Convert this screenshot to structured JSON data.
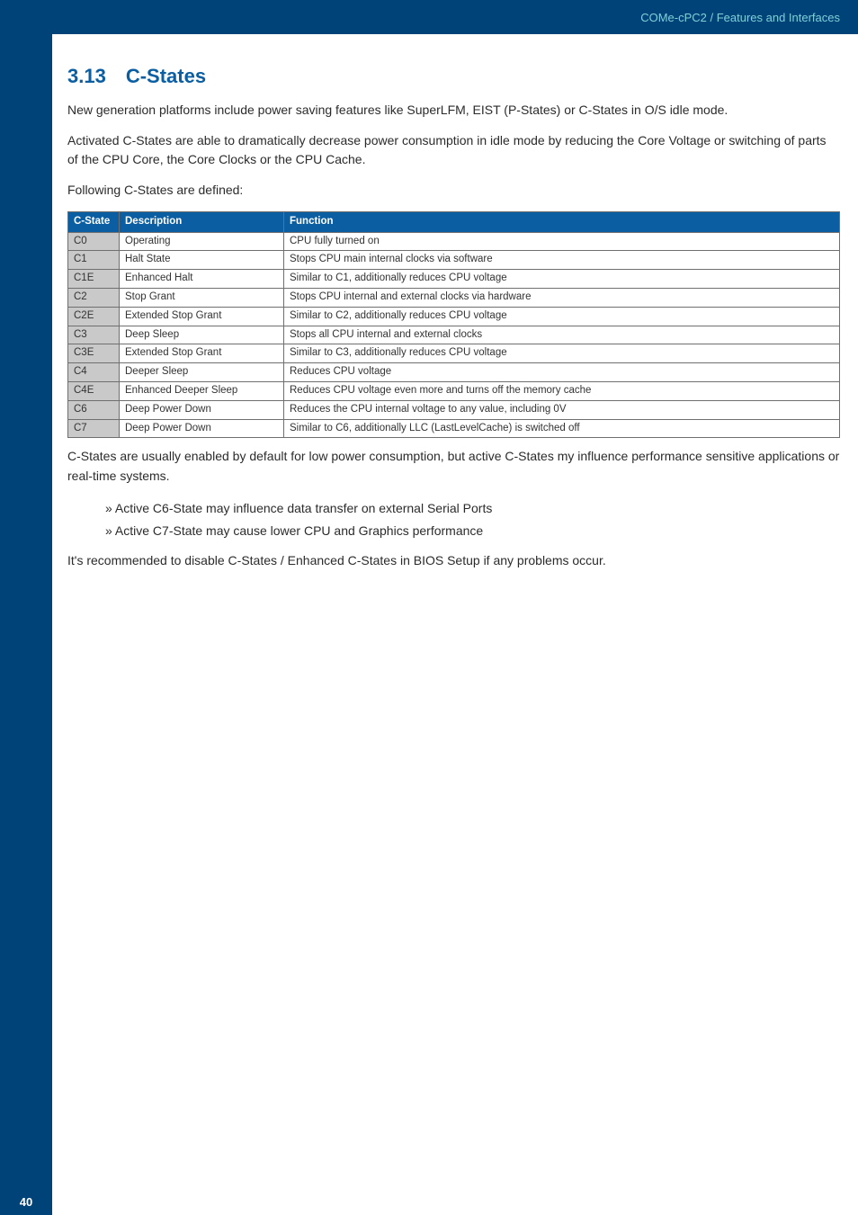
{
  "header": {
    "breadcrumb": "COMe-cPC2 / Features and Interfaces"
  },
  "section": {
    "number": "3.13",
    "title": "C-States",
    "para1": "New generation platforms include power saving features like SuperLFM, EIST (P-States) or C-States in O/S idle mode.",
    "para2": "Activated C-States are able to dramatically decrease power consumption in idle mode by reducing the Core Voltage or switching of parts of the CPU Core, the Core Clocks or the CPU Cache.",
    "para3": "Following C-States are defined:"
  },
  "table": {
    "headers": {
      "state": "C-State",
      "desc": "Description",
      "func": "Function"
    },
    "rows": [
      {
        "state": "C0",
        "desc": "Operating",
        "func": "CPU fully turned on"
      },
      {
        "state": "C1",
        "desc": "Halt State",
        "func": "Stops CPU main internal clocks via software"
      },
      {
        "state": "C1E",
        "desc": "Enhanced Halt",
        "func": "Similar to C1, additionally reduces CPU voltage"
      },
      {
        "state": "C2",
        "desc": "Stop Grant",
        "func": "Stops CPU internal and external clocks via hardware"
      },
      {
        "state": "C2E",
        "desc": "Extended Stop Grant",
        "func": "Similar to C2, additionally reduces CPU voltage"
      },
      {
        "state": "C3",
        "desc": "Deep Sleep",
        "func": "Stops all CPU internal and external clocks"
      },
      {
        "state": "C3E",
        "desc": "Extended Stop Grant",
        "func": "Similar to C3, additionally reduces CPU voltage"
      },
      {
        "state": "C4",
        "desc": "Deeper Sleep",
        "func": "Reduces CPU voltage"
      },
      {
        "state": "C4E",
        "desc": "Enhanced Deeper Sleep",
        "func": "Reduces CPU voltage even more and turns off the memory cache"
      },
      {
        "state": "C6",
        "desc": "Deep Power Down",
        "func": "Reduces the CPU internal voltage to any value, including 0V"
      },
      {
        "state": "C7",
        "desc": "Deep Power Down",
        "func": "Similar to C6, additionally LLC (LastLevelCache) is switched off"
      }
    ]
  },
  "after_table": {
    "para1": "C-States are usually enabled by default for low power consumption, but active C-States my influence performance sensitive applications or real-time systems.",
    "bullets": [
      "» Active C6-State may influence data transfer on external Serial Ports",
      "» Active C7-State may cause lower CPU and Graphics performance"
    ],
    "para2": "It's recommended to disable C-States / Enhanced C-States in BIOS Setup if any problems occur."
  },
  "page_number": "40"
}
